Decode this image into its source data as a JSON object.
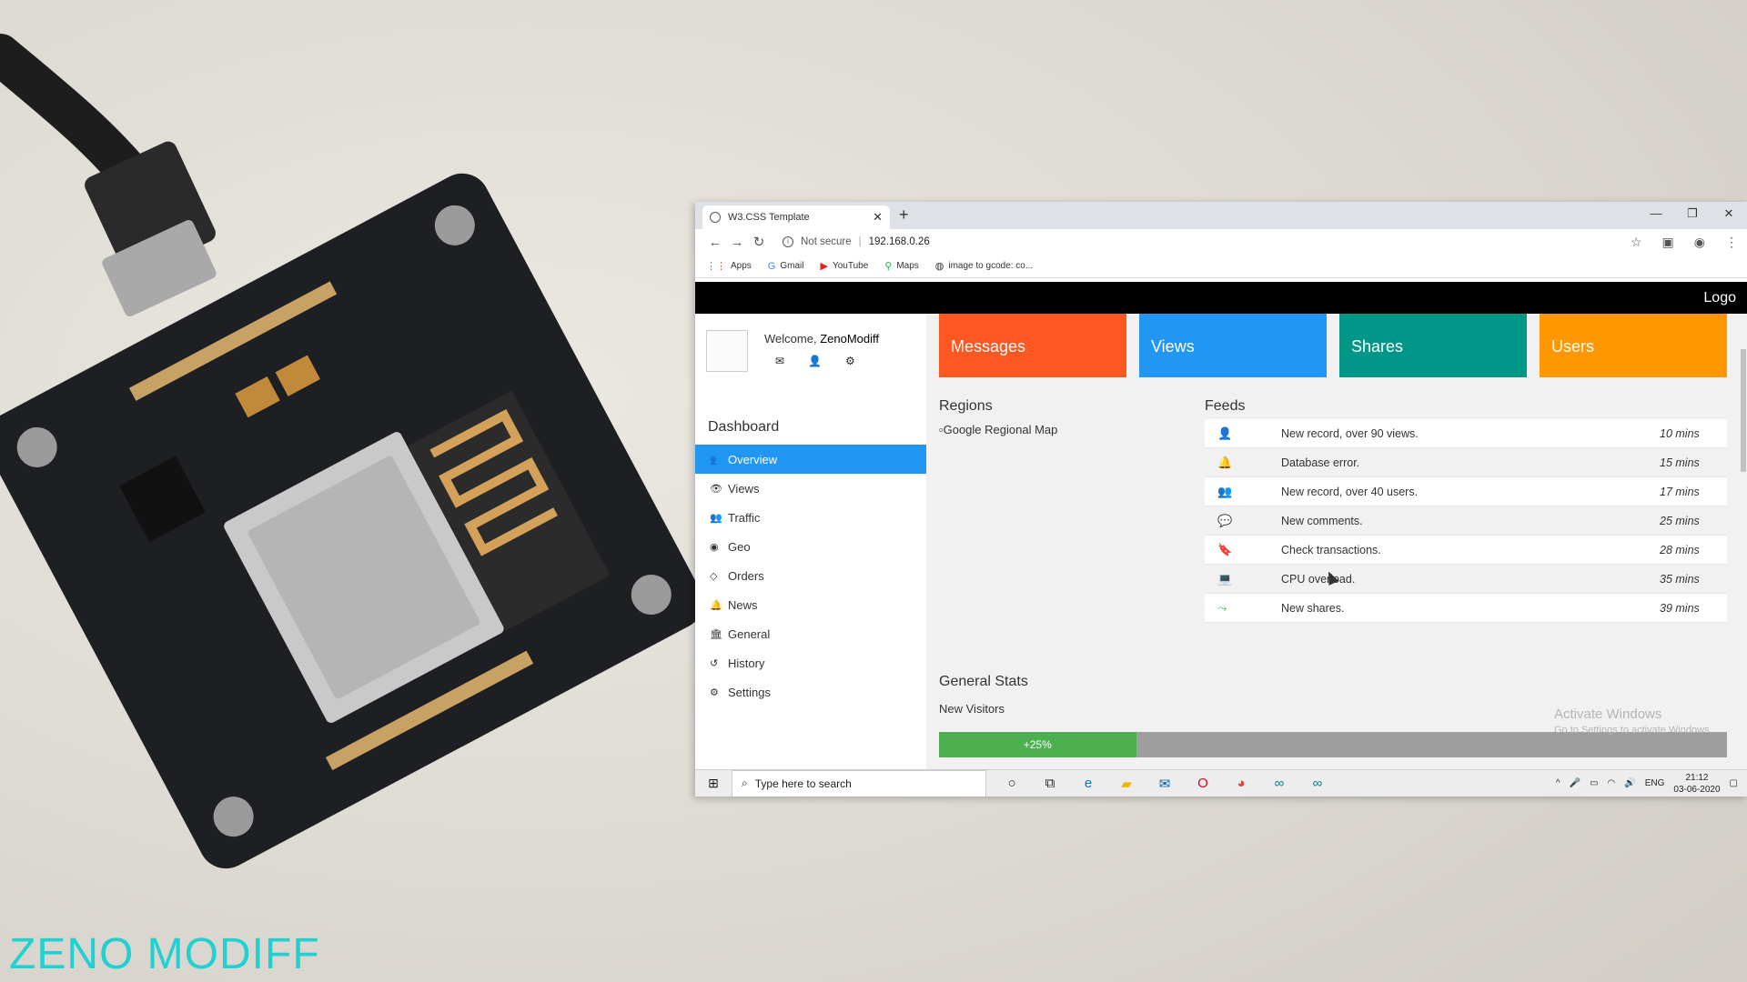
{
  "watermark": "ZENO MODIFF",
  "browser": {
    "tab_title": "W3.CSS Template",
    "security": "Not secure",
    "url": "192.168.0.26",
    "bookmarks": [
      "Apps",
      "Gmail",
      "YouTube",
      "Maps",
      "image to gcode: co..."
    ]
  },
  "page": {
    "logo": "Logo",
    "welcome_prefix": "Welcome,",
    "username": "ZenoModiff",
    "dashboard_title": "Dashboard",
    "menu": [
      {
        "label": "Overview",
        "icon": "users-icon"
      },
      {
        "label": "Views",
        "icon": "eye-icon"
      },
      {
        "label": "Traffic",
        "icon": "users-icon"
      },
      {
        "label": "Geo",
        "icon": "bullseye-icon"
      },
      {
        "label": "Orders",
        "icon": "diamond-icon"
      },
      {
        "label": "News",
        "icon": "bell-icon"
      },
      {
        "label": "General",
        "icon": "bank-icon"
      },
      {
        "label": "History",
        "icon": "history-icon"
      },
      {
        "label": "Settings",
        "icon": "cog-icon"
      }
    ],
    "active_menu": "Overview",
    "cards": [
      {
        "label": "Messages",
        "color": "#ff5722"
      },
      {
        "label": "Views",
        "color": "#2196f3"
      },
      {
        "label": "Shares",
        "color": "#009688"
      },
      {
        "label": "Users",
        "color": "#ff9800"
      }
    ],
    "regions_title": "Regions",
    "map_alt": "Google Regional Map",
    "feeds_title": "Feeds",
    "feeds": [
      {
        "text": "New record, over 90 views.",
        "time": "10 mins",
        "icon": "user-icon",
        "color": "#2196f3"
      },
      {
        "text": "Database error.",
        "time": "15 mins",
        "icon": "bell-icon",
        "color": "#f44336"
      },
      {
        "text": "New record, over 40 users.",
        "time": "17 mins",
        "icon": "users-icon",
        "color": "#ffc107"
      },
      {
        "text": "New comments.",
        "time": "25 mins",
        "icon": "comment-icon",
        "color": "#f44336"
      },
      {
        "text": "Check transactions.",
        "time": "28 mins",
        "icon": "bookmark-icon",
        "color": "#2196f3"
      },
      {
        "text": "CPU overload.",
        "time": "35 mins",
        "icon": "laptop-icon",
        "color": "#f44336"
      },
      {
        "text": "New shares.",
        "time": "39 mins",
        "icon": "share-icon",
        "color": "#4caf50"
      }
    ],
    "general_stats_title": "General Stats",
    "new_visitors_label": "New Visitors",
    "new_visitors_percent": 25,
    "new_visitors_text": "+25%",
    "activate_windows": "Activate Windows",
    "activate_windows_sub": "Go to Settings to activate Windows."
  },
  "taskbar": {
    "search_placeholder": "Type here to search",
    "language": "ENG",
    "time": "21:12",
    "date": "03-06-2020"
  }
}
